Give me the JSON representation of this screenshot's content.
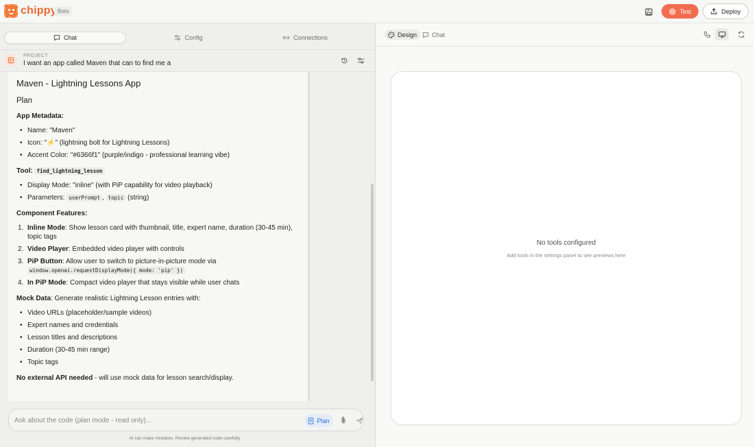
{
  "app": {
    "name": "chippy",
    "badge": "Beta"
  },
  "header": {
    "save_icon": "save-icon",
    "test_label": "Test",
    "deploy_label": "Deploy"
  },
  "left_tabs": [
    {
      "label": "Chat",
      "icon": "chat-icon",
      "active": true
    },
    {
      "label": "Config",
      "icon": "sliders-icon",
      "active": false
    },
    {
      "label": "Connections",
      "icon": "link-icon",
      "active": false
    }
  ],
  "project": {
    "label": "PROJECT",
    "title": "I want an app called Maven that can to find me a"
  },
  "message": {
    "title": "Maven - Lightning Lessons App",
    "plan_heading": "Plan",
    "metadata_heading": "App Metadata:",
    "metadata_items": [
      "Name: \"Maven\"",
      "Icon: \"⚡\" (lightning bolt for Lightning Lessons)",
      "Accent Color: \"#6366f1\" (purple/indigo - professional learning vibe)"
    ],
    "tool_label": "Tool:",
    "tool_code": "find_lightning_lesson",
    "tool_items": {
      "display_mode": "Display Mode: \"inline\" (with PiP capability for video playback)",
      "params_prefix": "Parameters:",
      "param1": "userPrompt",
      "comma": ",",
      "param2": "topic",
      "params_suffix": "(string)"
    },
    "features_heading": "Component Features:",
    "features": {
      "f1_num": "1.",
      "f1_bold": "Inline Mode",
      "f1_text": ": Show lesson card with thumbnail, title, expert name, duration (30-45 min), topic tags",
      "f2_num": "2.",
      "f2_bold": "Video Player",
      "f2_text": ": Embedded video player with controls",
      "f3_num": "3.",
      "f3_bold": "PiP Button",
      "f3_text": ": Allow user to switch to picture-in-picture mode via",
      "f3_code": "window.openai.requestDisplayMode({ mode: 'pip' })",
      "f4_num": "4.",
      "f4_bold": "In PiP Mode",
      "f4_text": ": Compact video player that stays visible while user chats"
    },
    "mock_bold": "Mock Data",
    "mock_text": ": Generate realistic Lightning Lesson entries with:",
    "mock_items": [
      "Video URLs (placeholder/sample videos)",
      "Expert names and credentials",
      "Lesson titles and descriptions",
      "Duration (30-45 min range)",
      "Topic tags"
    ],
    "api_bold": "No external API needed",
    "api_text": " - will use mock data for lesson search/display."
  },
  "composer": {
    "placeholder": "Ask about the code (plan mode - read only)...",
    "plan_label": "Plan",
    "disclaimer": "AI can make mistakes. Review generated code carefully."
  },
  "right_tabs": [
    {
      "label": "Design",
      "icon": "palette-icon",
      "active": true
    },
    {
      "label": "Chat",
      "icon": "chat-icon",
      "active": false
    }
  ],
  "preview": {
    "empty_title": "No tools configured",
    "empty_subtitle": "Add tools in the settings panel to see previews here"
  },
  "colors": {
    "accent": "#e8692f",
    "test_button": "#f26c4f",
    "plan_blue": "#2d6fd2"
  }
}
